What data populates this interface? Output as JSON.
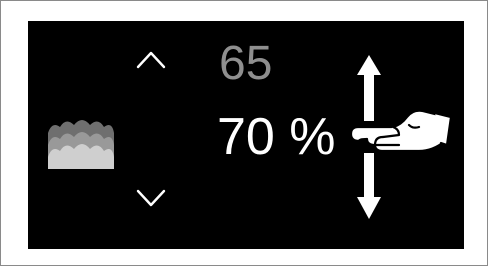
{
  "setting": {
    "previous_value": "65",
    "current_value": "70 %",
    "current_percent": 70
  },
  "icons": {
    "humidity": "humidity-icon",
    "increase": "chevron-up-icon",
    "decrease": "chevron-down-icon",
    "scroll_hint": "swipe-vertical-hand-icon"
  },
  "colors": {
    "screen_background": "#000000",
    "active_text": "#ffffff",
    "inactive_text": "#8f8f8f"
  }
}
